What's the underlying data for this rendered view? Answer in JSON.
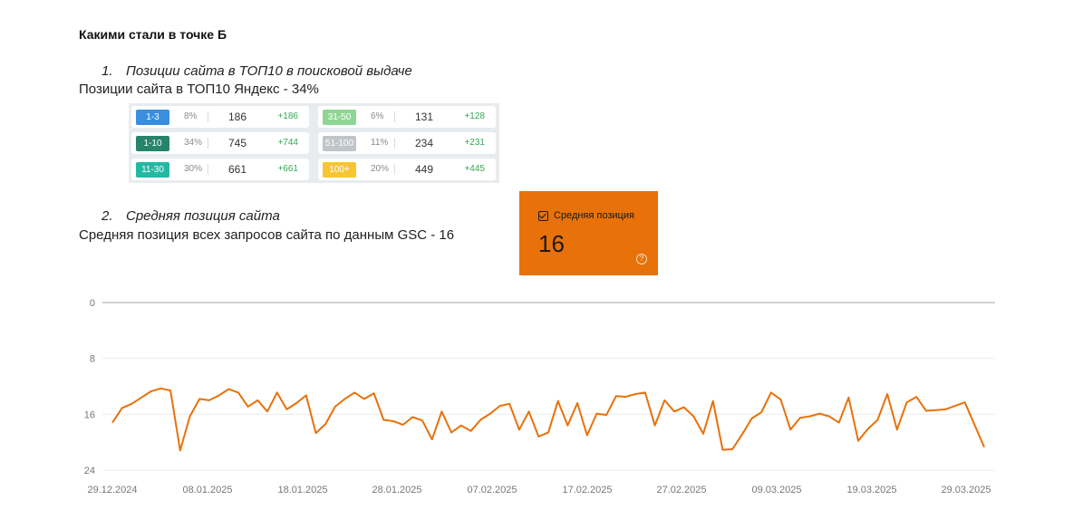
{
  "heading": "Какими стали в точке Б",
  "section1": {
    "number": "1.",
    "title": "Позиции сайта в ТОП10 в поисковой выдаче",
    "text": "Позиции сайта в ТОП10 Яндекс - 34%"
  },
  "positions_table": {
    "left": [
      {
        "range": "1-3",
        "color": "#3a8ee0",
        "pct": "8%",
        "count": "186",
        "delta": "+186"
      },
      {
        "range": "1-10",
        "color": "#26846a",
        "pct": "34%",
        "count": "745",
        "delta": "+744"
      },
      {
        "range": "11-30",
        "color": "#22b9a2",
        "pct": "30%",
        "count": "661",
        "delta": "+661"
      }
    ],
    "right": [
      {
        "range": "31-50",
        "color": "#8fd694",
        "pct": "6%",
        "count": "131",
        "delta": "+128"
      },
      {
        "range": "51-100",
        "color": "#c0c5ca",
        "pct": "11%",
        "count": "234",
        "delta": "+231"
      },
      {
        "range": "100+",
        "color": "#f7c531",
        "pct": "20%",
        "count": "449",
        "delta": "+445"
      }
    ]
  },
  "section2": {
    "number": "2.",
    "title": "Средняя позиция сайта",
    "text": "Средняя позиция всех запросов сайта по данным GSC - 16"
  },
  "metric_card": {
    "label": "Средняя позиция",
    "value": "16",
    "color": "#e8710a",
    "help_icon": "question-circle-icon"
  },
  "chart_data": {
    "type": "line",
    "color": "#e8710a",
    "y_reversed": true,
    "ylim": [
      0,
      24
    ],
    "y_ticks": [
      "0",
      "8",
      "16",
      "24"
    ],
    "x_tick_labels": [
      "29.12.2024",
      "08.01.2025",
      "18.01.2025",
      "28.01.2025",
      "07.02.2025",
      "17.02.2025",
      "27.02.2025",
      "09.03.2025",
      "19.03.2025",
      "29.03.2025"
    ],
    "x_start": "2024-12-30",
    "values": [
      17.2,
      15.1,
      14.5,
      13.6,
      12.7,
      12.3,
      12.6,
      21.2,
      16.3,
      13.8,
      14.0,
      13.3,
      12.4,
      12.9,
      14.9,
      14.0,
      15.6,
      12.9,
      15.3,
      14.4,
      13.3,
      18.7,
      17.4,
      14.9,
      13.8,
      12.9,
      13.8,
      13.0,
      16.8,
      17.0,
      17.5,
      16.4,
      16.9,
      19.6,
      15.6,
      18.6,
      17.6,
      18.4,
      16.8,
      15.9,
      14.8,
      14.5,
      18.2,
      15.6,
      19.2,
      18.6,
      14.1,
      17.6,
      14.4,
      19.0,
      15.9,
      16.1,
      13.4,
      13.5,
      13.1,
      12.9,
      17.6,
      14.0,
      15.6,
      15.0,
      16.3,
      18.8,
      14.1,
      21.1,
      21.0,
      18.9,
      16.6,
      15.7,
      12.9,
      13.9,
      18.2,
      16.5,
      16.3,
      15.9,
      16.3,
      17.2,
      13.6,
      19.8,
      18.1,
      16.8,
      13.1,
      18.2,
      14.3,
      13.5,
      15.5,
      15.4,
      15.3,
      14.8,
      14.3,
      17.5,
      20.7
    ]
  }
}
